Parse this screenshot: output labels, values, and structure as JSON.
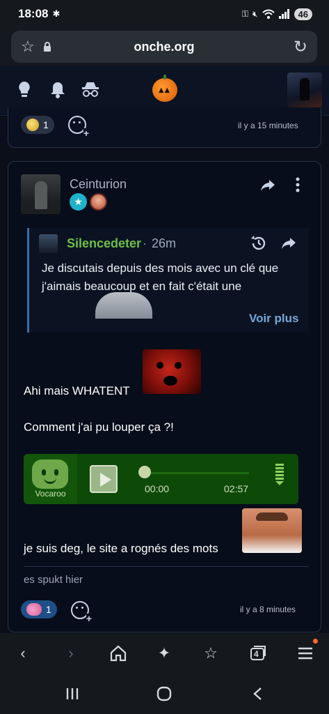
{
  "status_bar": {
    "time": "18:08",
    "battery": "46"
  },
  "browser": {
    "url": "onche.org",
    "tabs_count": "4"
  },
  "previous_post": {
    "reaction_count": "1",
    "time_ago": "il y a 15 minutes"
  },
  "post": {
    "author": "Ceinturion",
    "quote": {
      "author": "Silencedeter",
      "separator": "·",
      "time": "26m",
      "text": "Je discutais depuis des mois avec un clé que j'aimais beaucoup et en fait c'était une",
      "more_label": "Voir plus"
    },
    "line1": "Ahi mais WHATENT",
    "line2": "Comment j'ai pu louper ça ?!",
    "audio": {
      "brand": "Vocaroo",
      "current_time": "00:00",
      "duration": "02:57",
      "progress": 0
    },
    "line3": "je suis deg, le site a rognés des mots",
    "signature": "es spukt hier",
    "reaction_count": "1",
    "time_ago": "il y a 8 minutes"
  },
  "colors": {
    "accent_green": "#6fbf4a",
    "link_blue": "#78a7d8",
    "vocaroo_green": "#0e4a07"
  }
}
